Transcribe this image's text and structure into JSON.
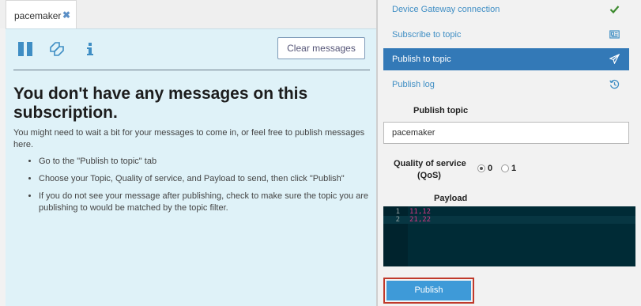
{
  "tab": {
    "label": "pacemaker",
    "close_glyph": "✖"
  },
  "messages": {
    "clear_button": "Clear messages",
    "heading": "You don't have any messages on this subscription.",
    "subtext": "You might need to wait a bit for your messages to come in, or feel free to publish messages here.",
    "bullets": [
      "Go to the \"Publish to topic\" tab",
      "Choose your Topic, Quality of service, and Payload to send, then click \"Publish\"",
      "If you do not see your message after publishing, check to make sure the topic you are publishing to would be matched by the topic filter."
    ],
    "toolbar_icons": [
      "pause-icon",
      "copy-icon",
      "info-icon"
    ]
  },
  "sidebar": {
    "items": [
      {
        "label": "Device Gateway connection",
        "icon": "check-icon"
      },
      {
        "label": "Subscribe to topic",
        "icon": "id-card-icon"
      },
      {
        "label": "Publish to topic",
        "icon": "paper-plane-icon",
        "active": true
      },
      {
        "label": "Publish log",
        "icon": "history-icon"
      }
    ]
  },
  "publish": {
    "topic_label": "Publish topic",
    "topic_value": "pacemaker",
    "qos_label_line1": "Quality of service",
    "qos_label_line2": "(QoS)",
    "qos_options": [
      "0",
      "1"
    ],
    "qos_selected": "0",
    "payload_label": "Payload",
    "payload_lines": [
      {
        "number": "1",
        "text": "11,12"
      },
      {
        "number": "2",
        "text": "21,22"
      }
    ],
    "button_label": "Publish"
  },
  "colors": {
    "accent": "#3379b7",
    "link": "#3f8ec4",
    "panel_bg": "#dff2f8",
    "editor_bg": "#002b36",
    "highlight_border": "#c0392b",
    "button": "#3e9ad8",
    "check": "#3c8a2e"
  }
}
